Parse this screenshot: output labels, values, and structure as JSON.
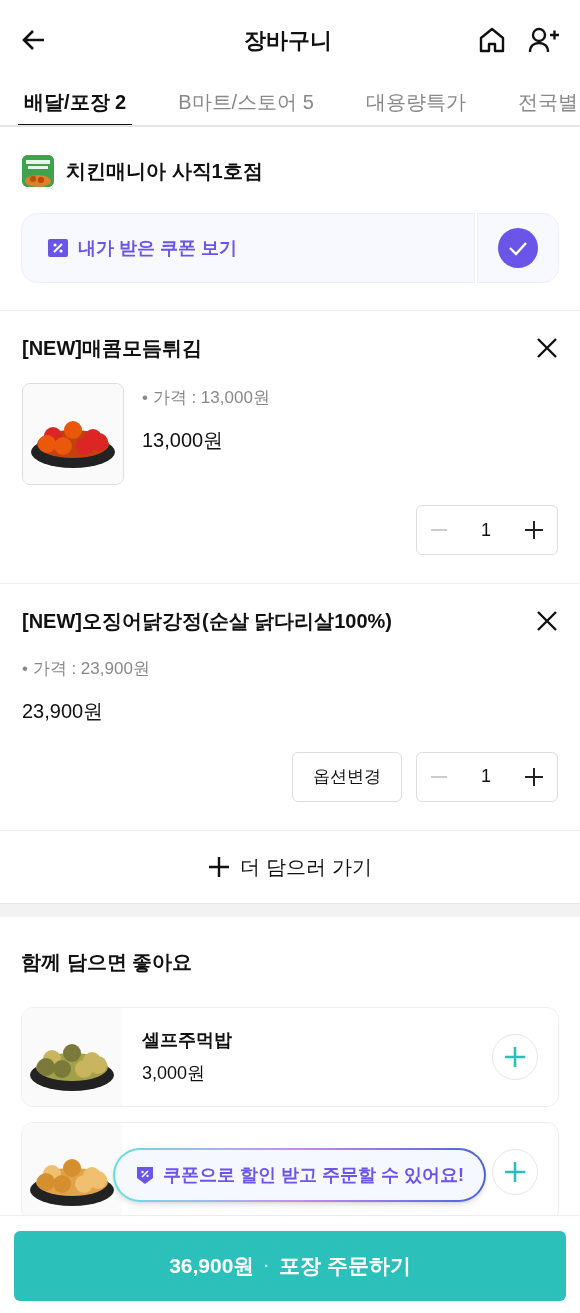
{
  "header": {
    "title": "장바구니"
  },
  "tabs": [
    {
      "label": "배달/포장 2",
      "selected": true
    },
    {
      "label": "B마트/스토어 5",
      "selected": false
    },
    {
      "label": "대용량특가",
      "selected": false
    },
    {
      "label": "전국별",
      "selected": false
    }
  ],
  "store": {
    "name": "치킨매니아 사직1호점"
  },
  "coupon": {
    "label": "내가 받은 쿠폰 보기",
    "checked": true
  },
  "cart_items": [
    {
      "kind": "with_image",
      "name": "[NEW]매콤모듬튀김",
      "price_label": "• 가격 : 13,000원",
      "price": "13,000원",
      "quantity": "1"
    },
    {
      "kind": "text_only",
      "name": "[NEW]오징어닭강정(순살 닭다리살100%)",
      "price_label": "• 가격 : 23,900원",
      "price": "23,900원",
      "quantity": "1",
      "option_button": "옵션변경"
    }
  ],
  "add_more": {
    "label": "더 담으러 가기"
  },
  "recommendations": {
    "title": "함께 담으면 좋아요",
    "items": [
      {
        "kind": "full",
        "name": "셀프주먹밥",
        "price": "3,000원"
      },
      {
        "kind": "covered"
      }
    ]
  },
  "toast": {
    "text": "쿠폰으로 할인 받고 주문할 수 있어요!"
  },
  "order_button": {
    "amount": "36,900원",
    "separator": "·",
    "label": "포장 주문하기"
  }
}
